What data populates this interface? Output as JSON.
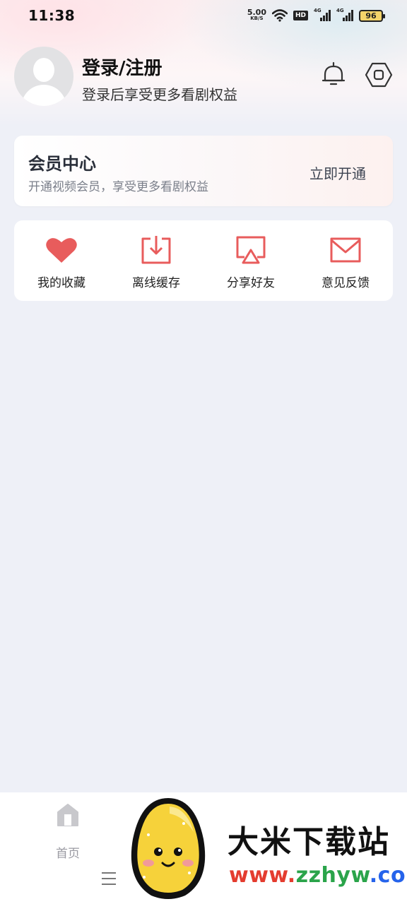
{
  "status_bar": {
    "time": "11:38",
    "net_speed_value": "5.00",
    "net_speed_unit": "KB/S",
    "hd_badge": "HD",
    "sim1_label": "4G",
    "sim2_label": "4G",
    "battery_level": "96"
  },
  "profile": {
    "title": "登录/注册",
    "subtitle": "登录后享受更多看剧权益",
    "icons": [
      "bell-icon",
      "settings-icon"
    ]
  },
  "vip": {
    "title": "会员中心",
    "subtitle": "开通视频会员，享受更多看剧权益",
    "action": "立即开通"
  },
  "functions": [
    {
      "label": "我的收藏",
      "icon": "heart-icon"
    },
    {
      "label": "离线缓存",
      "icon": "download-icon"
    },
    {
      "label": "分享好友",
      "icon": "share-screen-icon"
    },
    {
      "label": "意见反馈",
      "icon": "mail-icon"
    }
  ],
  "bottom_nav": {
    "home_label": "首页"
  },
  "watermark": {
    "name": "大米下载站",
    "url_part1": "www.",
    "url_part2": "zzhyw",
    "url_part3": ".com"
  },
  "colors": {
    "accent_red": "#e85c5c",
    "background": "#eef0f7",
    "card": "#ffffff"
  }
}
